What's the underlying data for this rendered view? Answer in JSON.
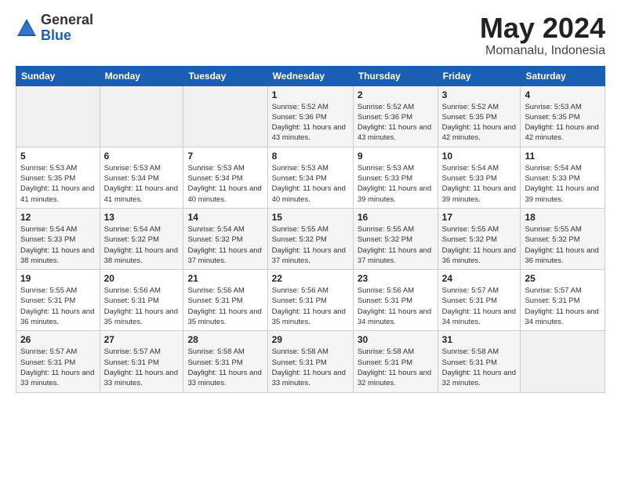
{
  "logo": {
    "general": "General",
    "blue": "Blue"
  },
  "title": "May 2024",
  "location": "Momanalu, Indonesia",
  "days_of_week": [
    "Sunday",
    "Monday",
    "Tuesday",
    "Wednesday",
    "Thursday",
    "Friday",
    "Saturday"
  ],
  "weeks": [
    [
      {
        "day": "",
        "info": ""
      },
      {
        "day": "",
        "info": ""
      },
      {
        "day": "",
        "info": ""
      },
      {
        "day": "1",
        "info": "Sunrise: 5:52 AM\nSunset: 5:36 PM\nDaylight: 11 hours and 43 minutes."
      },
      {
        "day": "2",
        "info": "Sunrise: 5:52 AM\nSunset: 5:36 PM\nDaylight: 11 hours and 43 minutes."
      },
      {
        "day": "3",
        "info": "Sunrise: 5:52 AM\nSunset: 5:35 PM\nDaylight: 11 hours and 42 minutes."
      },
      {
        "day": "4",
        "info": "Sunrise: 5:53 AM\nSunset: 5:35 PM\nDaylight: 11 hours and 42 minutes."
      }
    ],
    [
      {
        "day": "5",
        "info": "Sunrise: 5:53 AM\nSunset: 5:35 PM\nDaylight: 11 hours and 41 minutes."
      },
      {
        "day": "6",
        "info": "Sunrise: 5:53 AM\nSunset: 5:34 PM\nDaylight: 11 hours and 41 minutes."
      },
      {
        "day": "7",
        "info": "Sunrise: 5:53 AM\nSunset: 5:34 PM\nDaylight: 11 hours and 40 minutes."
      },
      {
        "day": "8",
        "info": "Sunrise: 5:53 AM\nSunset: 5:34 PM\nDaylight: 11 hours and 40 minutes."
      },
      {
        "day": "9",
        "info": "Sunrise: 5:53 AM\nSunset: 5:33 PM\nDaylight: 11 hours and 39 minutes."
      },
      {
        "day": "10",
        "info": "Sunrise: 5:54 AM\nSunset: 5:33 PM\nDaylight: 11 hours and 39 minutes."
      },
      {
        "day": "11",
        "info": "Sunrise: 5:54 AM\nSunset: 5:33 PM\nDaylight: 11 hours and 39 minutes."
      }
    ],
    [
      {
        "day": "12",
        "info": "Sunrise: 5:54 AM\nSunset: 5:33 PM\nDaylight: 11 hours and 38 minutes."
      },
      {
        "day": "13",
        "info": "Sunrise: 5:54 AM\nSunset: 5:32 PM\nDaylight: 11 hours and 38 minutes."
      },
      {
        "day": "14",
        "info": "Sunrise: 5:54 AM\nSunset: 5:32 PM\nDaylight: 11 hours and 37 minutes."
      },
      {
        "day": "15",
        "info": "Sunrise: 5:55 AM\nSunset: 5:32 PM\nDaylight: 11 hours and 37 minutes."
      },
      {
        "day": "16",
        "info": "Sunrise: 5:55 AM\nSunset: 5:32 PM\nDaylight: 11 hours and 37 minutes."
      },
      {
        "day": "17",
        "info": "Sunrise: 5:55 AM\nSunset: 5:32 PM\nDaylight: 11 hours and 36 minutes."
      },
      {
        "day": "18",
        "info": "Sunrise: 5:55 AM\nSunset: 5:32 PM\nDaylight: 11 hours and 36 minutes."
      }
    ],
    [
      {
        "day": "19",
        "info": "Sunrise: 5:55 AM\nSunset: 5:31 PM\nDaylight: 11 hours and 36 minutes."
      },
      {
        "day": "20",
        "info": "Sunrise: 5:56 AM\nSunset: 5:31 PM\nDaylight: 11 hours and 35 minutes."
      },
      {
        "day": "21",
        "info": "Sunrise: 5:56 AM\nSunset: 5:31 PM\nDaylight: 11 hours and 35 minutes."
      },
      {
        "day": "22",
        "info": "Sunrise: 5:56 AM\nSunset: 5:31 PM\nDaylight: 11 hours and 35 minutes."
      },
      {
        "day": "23",
        "info": "Sunrise: 5:56 AM\nSunset: 5:31 PM\nDaylight: 11 hours and 34 minutes."
      },
      {
        "day": "24",
        "info": "Sunrise: 5:57 AM\nSunset: 5:31 PM\nDaylight: 11 hours and 34 minutes."
      },
      {
        "day": "25",
        "info": "Sunrise: 5:57 AM\nSunset: 5:31 PM\nDaylight: 11 hours and 34 minutes."
      }
    ],
    [
      {
        "day": "26",
        "info": "Sunrise: 5:57 AM\nSunset: 5:31 PM\nDaylight: 11 hours and 33 minutes."
      },
      {
        "day": "27",
        "info": "Sunrise: 5:57 AM\nSunset: 5:31 PM\nDaylight: 11 hours and 33 minutes."
      },
      {
        "day": "28",
        "info": "Sunrise: 5:58 AM\nSunset: 5:31 PM\nDaylight: 11 hours and 33 minutes."
      },
      {
        "day": "29",
        "info": "Sunrise: 5:58 AM\nSunset: 5:31 PM\nDaylight: 11 hours and 33 minutes."
      },
      {
        "day": "30",
        "info": "Sunrise: 5:58 AM\nSunset: 5:31 PM\nDaylight: 11 hours and 32 minutes."
      },
      {
        "day": "31",
        "info": "Sunrise: 5:58 AM\nSunset: 5:31 PM\nDaylight: 11 hours and 32 minutes."
      },
      {
        "day": "",
        "info": ""
      }
    ]
  ]
}
